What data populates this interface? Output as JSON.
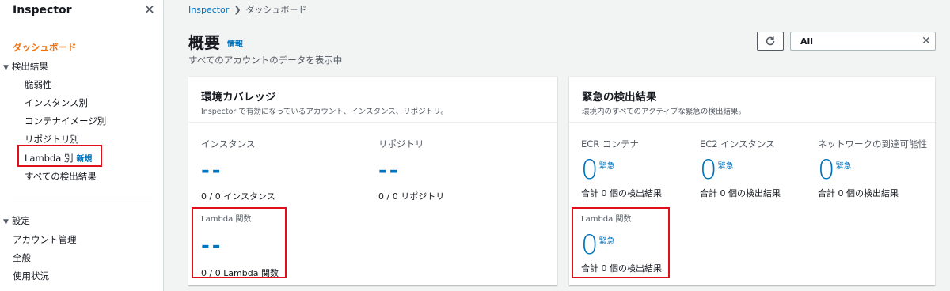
{
  "sidebar": {
    "title": "Inspector",
    "close_glyph": "✕",
    "dashboard": "ダッシュボード",
    "findings_group": "検出結果",
    "findings_items": [
      "脆弱性",
      "インスタンス別",
      "コンテナイメージ別",
      "リポジトリ別"
    ],
    "lambda_label": "Lambda 別",
    "new_badge": "新規",
    "all_findings": "すべての検出結果",
    "settings_group": "設定",
    "settings_items": [
      "アカウント管理",
      "全般",
      "使用状況"
    ],
    "caret": "▼"
  },
  "breadcrumb": {
    "root": "Inspector",
    "separator": "❯",
    "current": "ダッシュボード"
  },
  "page": {
    "title": "概要",
    "info": "情報",
    "description": "すべてのアカウントのデータを表示中",
    "refresh_icon": "↻",
    "search_value": "All",
    "search_clear": "✕"
  },
  "env_card": {
    "title": "環境カバレッジ",
    "subtitle": "Inspector で有効になっているアカウント、インスタンス、リポジトリ。",
    "instances": {
      "label": "インスタンス",
      "value": "--",
      "sub": "0 / 0 インスタンス"
    },
    "repos": {
      "label": "リポジトリ",
      "value": "--",
      "sub": "0 / 0 リポジトリ"
    },
    "lambda": {
      "label": "Lambda 関数",
      "value": "--",
      "sub": "0 / 0 Lambda 関数"
    }
  },
  "critical_card": {
    "title": "緊急の検出結果",
    "subtitle": "環境内のすべてのアクティブな緊急の検出結果。",
    "ecr": {
      "label": "ECR コンテナ",
      "count": "0",
      "unit": "緊急",
      "total": "合計 0 個の検出結果"
    },
    "ec2": {
      "label": "EC2 インスタンス",
      "count": "0",
      "unit": "緊急",
      "total": "合計 0 個の検出結果"
    },
    "network": {
      "label": "ネットワークの到達可能性",
      "count": "0",
      "unit": "緊急",
      "total": "合計 0 個の検出結果"
    },
    "lambda": {
      "label": "Lambda 関数",
      "count": "0",
      "unit": "緊急",
      "total": "合計 0 個の検出結果"
    }
  },
  "colors": {
    "accent_orange": "#ec7211",
    "link_blue": "#0073bb",
    "highlight_red": "#e0101a"
  }
}
